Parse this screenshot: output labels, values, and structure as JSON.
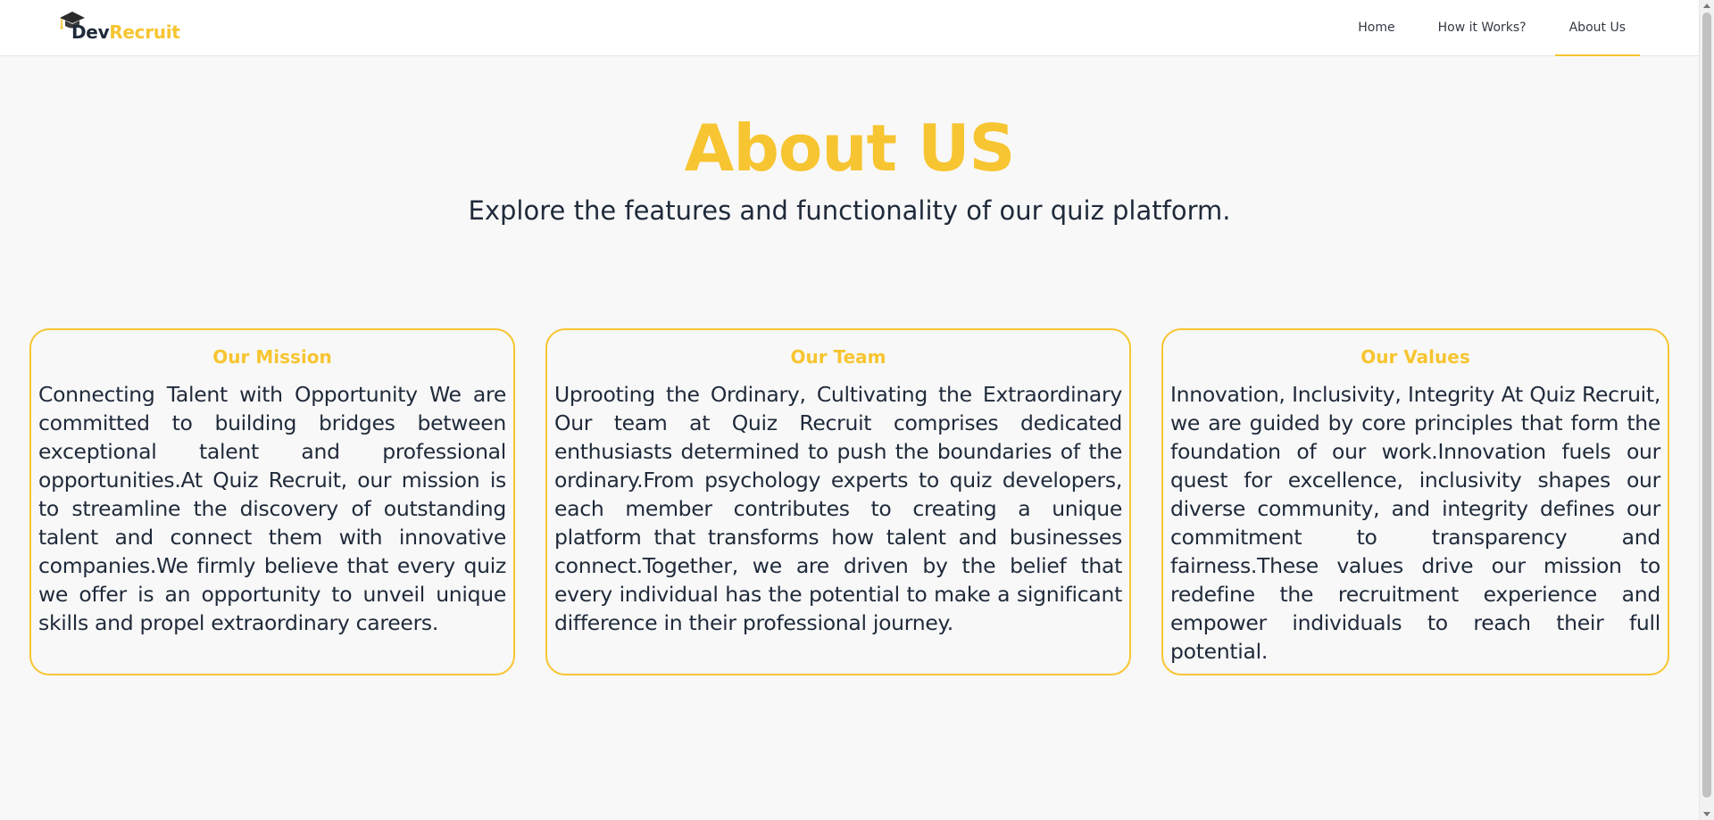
{
  "brand": {
    "logo_icon": "graduation-cap-icon",
    "name_part1": "Dev",
    "name_part2": "Recruit",
    "accent_color": "#f7c531",
    "text_color": "#1f2a3a"
  },
  "nav": {
    "items": [
      {
        "label": "Home",
        "active": false
      },
      {
        "label": "How it Works?",
        "active": false
      },
      {
        "label": "About Us",
        "active": true
      }
    ]
  },
  "hero": {
    "title": "About US",
    "subtitle": "Explore the features and functionality of our quiz platform."
  },
  "cards": [
    {
      "title": "Our Mission",
      "body": "Connecting Talent with Opportunity We are committed to building bridges between exceptional talent and professional opportunities.At Quiz Recruit, our mission is to streamline the discovery of outstanding talent and connect them with innovative companies.We firmly believe that every quiz we offer is an opportunity to unveil unique skills and propel extraordinary careers."
    },
    {
      "title": "Our Team",
      "body": "Uprooting the Ordinary, Cultivating the Extraordinary Our team at Quiz Recruit comprises dedicated enthusiasts determined to push the boundaries of the ordinary.From psychology experts to quiz developers, each member contributes to creating a unique platform that transforms how talent and businesses connect.Together, we are driven by the belief that every individual has the potential to make a significant difference in their professional journey."
    },
    {
      "title": "Our Values",
      "body": "Innovation, Inclusivity, Integrity At Quiz Recruit, we are guided by core principles that form the foundation of our work.Innovation fuels our quest for excellence, inclusivity shapes our diverse community, and integrity defines our commitment to transparency and fairness.These values drive our mission to redefine the recruitment experience and empower individuals to reach their full potential."
    }
  ]
}
